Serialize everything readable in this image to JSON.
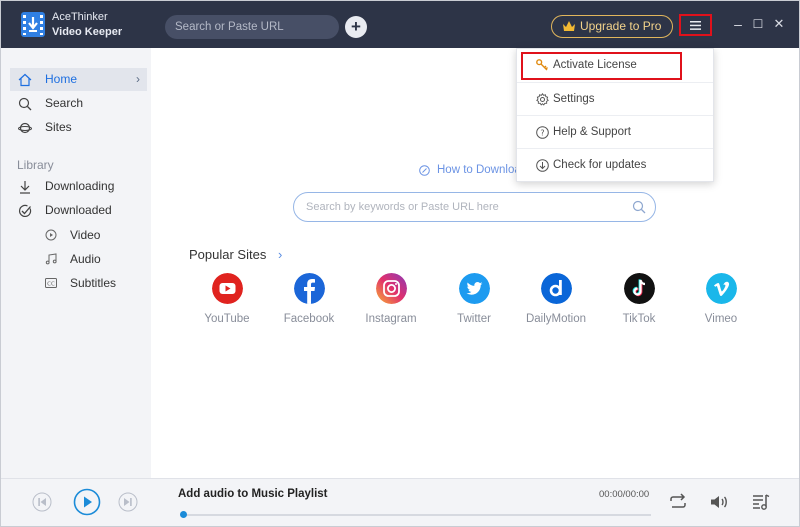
{
  "app": {
    "name_line1": "AceThinker",
    "name_line2": "Video Keeper",
    "logo_icon": "download-film-icon"
  },
  "titlebar": {
    "url_placeholder": "Search or Paste URL",
    "add_icon": "plus-icon",
    "upgrade_label": "Upgrade to Pro",
    "upgrade_icon": "crown-icon",
    "menu_icon": "hamburger-menu-icon",
    "minimize": "–",
    "maximize": "☐",
    "close": "✕"
  },
  "sidebar": {
    "items": [
      {
        "label": "Home",
        "icon": "home-icon",
        "active": true,
        "chevron": "›"
      },
      {
        "label": "Search",
        "icon": "search-icon"
      },
      {
        "label": "Sites",
        "icon": "planet-icon"
      }
    ],
    "library_label": "Library",
    "library": [
      {
        "label": "Downloading",
        "icon": "download-icon"
      },
      {
        "label": "Downloaded",
        "icon": "check-circle-icon"
      }
    ],
    "sub_items": [
      {
        "label": "Video",
        "icon": "play-circle-icon"
      },
      {
        "label": "Audio",
        "icon": "music-note-icon"
      },
      {
        "label": "Subtitles",
        "icon": "cc-icon"
      }
    ]
  },
  "main": {
    "how_to_label": "How to Downloa",
    "search_placeholder": "Search by keywords or Paste URL here",
    "popular_title": "Popular Sites",
    "popular_chevron": "›",
    "sites": [
      {
        "label": "YouTube",
        "icon": "youtube-icon",
        "color": "#e0231f"
      },
      {
        "label": "Facebook",
        "icon": "facebook-icon",
        "color": "#1b66d8"
      },
      {
        "label": "Instagram",
        "icon": "instagram-icon",
        "color": "#d6297c"
      },
      {
        "label": "Twitter",
        "icon": "twitter-icon",
        "color": "#1d9bf0"
      },
      {
        "label": "DailyMotion",
        "icon": "dailymotion-icon",
        "color": "#0a66d8"
      },
      {
        "label": "TikTok",
        "icon": "tiktok-icon",
        "color": "#111111"
      },
      {
        "label": "Vimeo",
        "icon": "vimeo-icon",
        "color": "#1ab7ea"
      }
    ]
  },
  "menu": {
    "items": [
      {
        "label": "Activate License",
        "icon": "key-icon",
        "highlighted": true
      },
      {
        "label": "Settings",
        "icon": "gear-icon"
      },
      {
        "label": "Help & Support",
        "icon": "question-circle-icon"
      },
      {
        "label": "Check for updates",
        "icon": "arrow-down-circle-icon"
      }
    ]
  },
  "player": {
    "prev_icon": "skip-previous-icon",
    "play_icon": "play-icon",
    "next_icon": "skip-next-icon",
    "title": "Add audio to Music Playlist",
    "time": "00:00/00:00",
    "progress": 0,
    "repeat_icon": "repeat-icon",
    "volume_icon": "volume-icon",
    "playlist_icon": "playlist-icon"
  },
  "colors": {
    "titlebar_bg": "#2d3447",
    "accent_blue": "#1e6fe0",
    "highlight_red": "#e0111b",
    "upgrade_gold": "#e1b65c"
  }
}
